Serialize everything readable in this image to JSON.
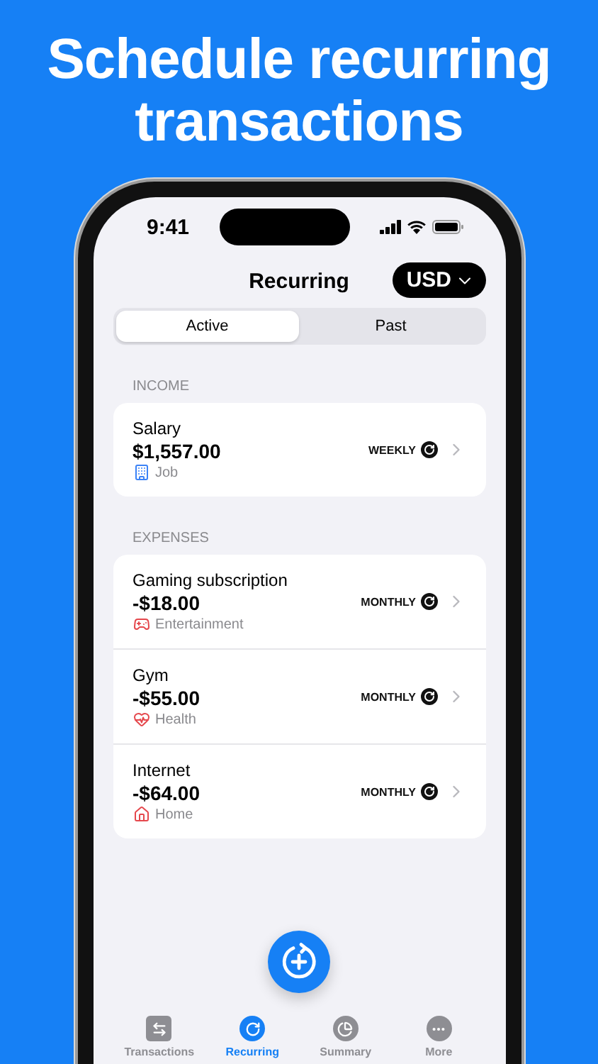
{
  "headline": "Schedule recurring transactions",
  "status_bar": {
    "time": "9:41"
  },
  "header": {
    "title": "Recurring",
    "currency": "USD"
  },
  "segments": [
    {
      "label": "Active",
      "selected": true
    },
    {
      "label": "Past",
      "selected": false
    }
  ],
  "sections": [
    {
      "title": "INCOME",
      "rows": [
        {
          "name": "Salary",
          "amount": "$1,557.00",
          "category": "Job",
          "color": "#3b82f6",
          "frequency": "WEEKLY"
        }
      ]
    },
    {
      "title": "EXPENSES",
      "rows": [
        {
          "name": "Gaming subscription",
          "amount": "-$18.00",
          "category": "Entertainment",
          "color": "#e5484d",
          "frequency": "MONTHLY"
        },
        {
          "name": "Gym",
          "amount": "-$55.00",
          "category": "Health",
          "color": "#e5484d",
          "frequency": "MONTHLY"
        },
        {
          "name": "Internet",
          "amount": "-$64.00",
          "category": "Home",
          "color": "#e5484d",
          "frequency": "MONTHLY"
        }
      ]
    }
  ],
  "tab_bar": [
    {
      "label": "Transactions",
      "selected": false
    },
    {
      "label": "Recurring",
      "selected": true
    },
    {
      "label": "Summary",
      "selected": false
    },
    {
      "label": "More",
      "selected": false
    }
  ]
}
